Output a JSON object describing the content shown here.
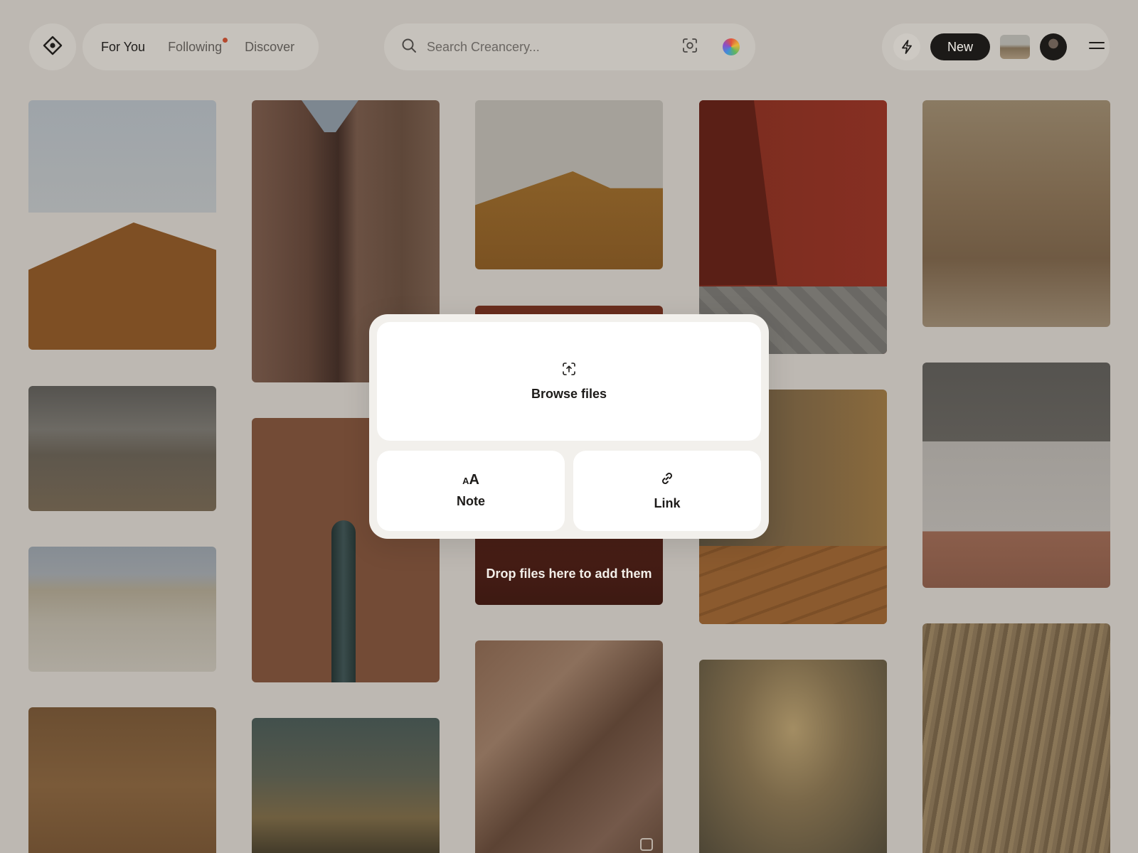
{
  "nav": {
    "logo_icon": "eye-diamond-icon",
    "tabs": [
      {
        "label": "For You",
        "active": true
      },
      {
        "label": "Following",
        "active": false,
        "has_notification": true
      },
      {
        "label": "Discover",
        "active": false
      }
    ]
  },
  "search": {
    "placeholder": "Search Creancery...",
    "icons": [
      "search-icon",
      "visual-search-icon",
      "color-filter-icon"
    ]
  },
  "actions": {
    "bolt_icon": "lightning-icon",
    "new_label": "New",
    "menu_icon": "menu-icon"
  },
  "grid": {
    "drop_text": "Drop files here to add them"
  },
  "modal": {
    "browse_label": "Browse files",
    "note_icon_text": "AA",
    "note_label": "Note",
    "link_label": "Link"
  },
  "colors": {
    "accent_dot": "#b5492e",
    "new_button_bg": "#1c1a18",
    "background": "#bdb8b2"
  }
}
